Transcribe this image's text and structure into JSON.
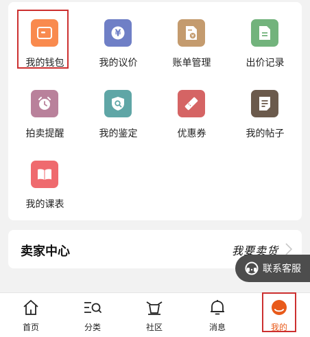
{
  "grid": [
    {
      "label": "我的钱包",
      "icon": "wallet-icon",
      "color": "#f98a4e"
    },
    {
      "label": "我的议价",
      "icon": "yen-icon",
      "color": "#6f7fc6"
    },
    {
      "label": "账单管理",
      "icon": "bill-icon",
      "color": "#c49b6e"
    },
    {
      "label": "出价记录",
      "icon": "document-icon",
      "color": "#72b37c"
    },
    {
      "label": "拍卖提醒",
      "icon": "alarm-icon",
      "color": "#b9819b"
    },
    {
      "label": "我的鉴定",
      "icon": "shield-search-icon",
      "color": "#5fa6a6"
    },
    {
      "label": "优惠券",
      "icon": "ticket-icon",
      "color": "#d56464"
    },
    {
      "label": "我的帖子",
      "icon": "post-icon",
      "color": "#6b5a4c"
    },
    {
      "label": "我的课表",
      "icon": "book-icon",
      "color": "#ef6a6e"
    }
  ],
  "seller": {
    "title": "卖家中心",
    "action": "我要卖货"
  },
  "service": {
    "label": "联系客服"
  },
  "tabs": [
    {
      "label": "首页",
      "icon": "home-icon"
    },
    {
      "label": "分类",
      "icon": "category-icon"
    },
    {
      "label": "社区",
      "icon": "community-icon"
    },
    {
      "label": "消息",
      "icon": "bell-icon"
    },
    {
      "label": "我的",
      "icon": "profile-icon"
    }
  ],
  "colors": {
    "accent": "#e85a1a",
    "highlight": "#cc2f2f"
  }
}
